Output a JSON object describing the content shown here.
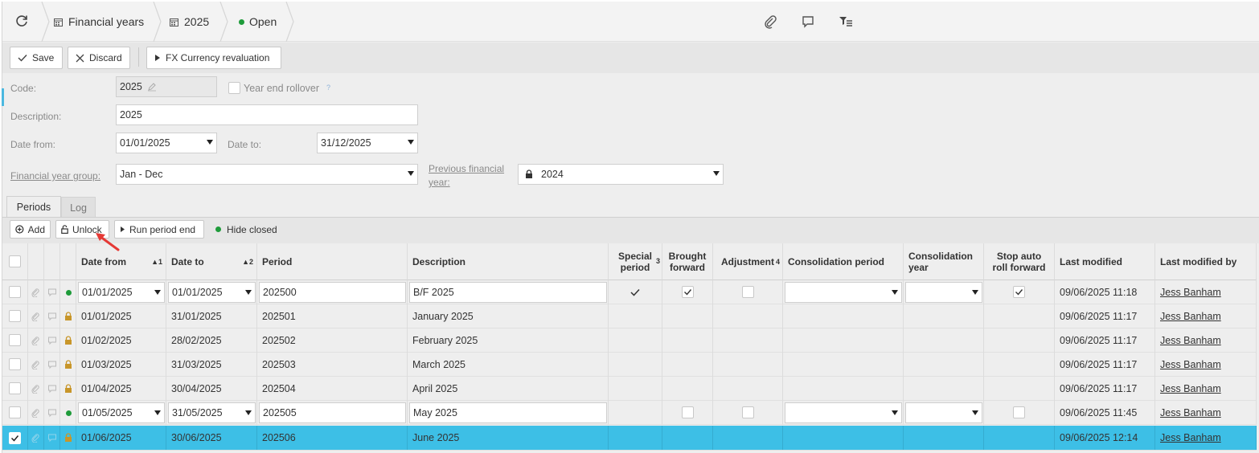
{
  "breadcrumb": {
    "items": [
      {
        "label": "Financial years",
        "icon": "calendar-icon"
      },
      {
        "label": "2025",
        "icon": "calendar-icon"
      },
      {
        "label": "Open",
        "icon": "status-dot"
      }
    ]
  },
  "toolbar": {
    "save_label": "Save",
    "discard_label": "Discard",
    "fx_label": "FX Currency revaluation"
  },
  "form": {
    "code_label": "Code:",
    "code_value": "2025",
    "year_end_rollover_label": "Year end rollover",
    "help_mark": "?",
    "description_label": "Description:",
    "description_value": "2025",
    "date_from_label": "Date from:",
    "date_from_value": "01/01/2025",
    "date_to_label": "Date to:",
    "date_to_value": "31/12/2025",
    "fy_group_label": "Financial year group:",
    "fy_group_value": "Jan - Dec",
    "prev_fy_label_1": "Previous financial",
    "prev_fy_label_2": "year:",
    "prev_fy_value": "2024"
  },
  "tabs": {
    "periods": "Periods",
    "log": "Log"
  },
  "grid_toolbar": {
    "add_label": "Add",
    "unlock_label": "Unlock",
    "run_period_end_label": "Run period end",
    "hide_closed_label": "Hide closed"
  },
  "columns": {
    "date_from": "Date from",
    "date_from_sort": "▲1",
    "date_to": "Date to",
    "date_to_sort": "▲2",
    "period": "Period",
    "description": "Description",
    "special_period_1": "Special",
    "special_period_2": "period",
    "special_sort": "3",
    "brought_forward_1": "Brought",
    "brought_forward_2": "forward",
    "adjustment": "Adjustment",
    "adjustment_sort": "4",
    "consolidation_period": "Consolidation period",
    "consolidation_year_1": "Consolidation",
    "consolidation_year_2": "year",
    "stop_auto_1": "Stop auto",
    "stop_auto_2": "roll forward",
    "last_modified": "Last modified",
    "last_modified_by": "Last modified by"
  },
  "rows": [
    {
      "date_from": "01/01/2025",
      "date_to": "01/01/2025",
      "period": "202500",
      "description": "B/F 2025",
      "last_modified": "09/06/2025 11:18",
      "last_modified_by": "Jess Banham",
      "state": "open-edit"
    },
    {
      "date_from": "01/01/2025",
      "date_to": "31/01/2025",
      "period": "202501",
      "description": "January 2025",
      "last_modified": "09/06/2025 11:17",
      "last_modified_by": "Jess Banham",
      "state": "locked"
    },
    {
      "date_from": "01/02/2025",
      "date_to": "28/02/2025",
      "period": "202502",
      "description": "February 2025",
      "last_modified": "09/06/2025 11:17",
      "last_modified_by": "Jess Banham",
      "state": "locked"
    },
    {
      "date_from": "01/03/2025",
      "date_to": "31/03/2025",
      "period": "202503",
      "description": "March 2025",
      "last_modified": "09/06/2025 11:17",
      "last_modified_by": "Jess Banham",
      "state": "locked"
    },
    {
      "date_from": "01/04/2025",
      "date_to": "30/04/2025",
      "period": "202504",
      "description": "April 2025",
      "last_modified": "09/06/2025 11:17",
      "last_modified_by": "Jess Banham",
      "state": "locked"
    },
    {
      "date_from": "01/05/2025",
      "date_to": "31/05/2025",
      "period": "202505",
      "description": "May 2025",
      "last_modified": "09/06/2025 11:45",
      "last_modified_by": "Jess Banham",
      "state": "open-edit"
    },
    {
      "date_from": "01/06/2025",
      "date_to": "30/06/2025",
      "period": "202506",
      "description": "June 2025",
      "last_modified": "09/06/2025 12:14",
      "last_modified_by": "Jess Banham",
      "state": "locked-selected"
    }
  ],
  "colors": {
    "selected_row": "#3dbfe6",
    "open_dot": "#1e9b3a",
    "lock": "#c8962a",
    "arrow": "#e53935"
  }
}
